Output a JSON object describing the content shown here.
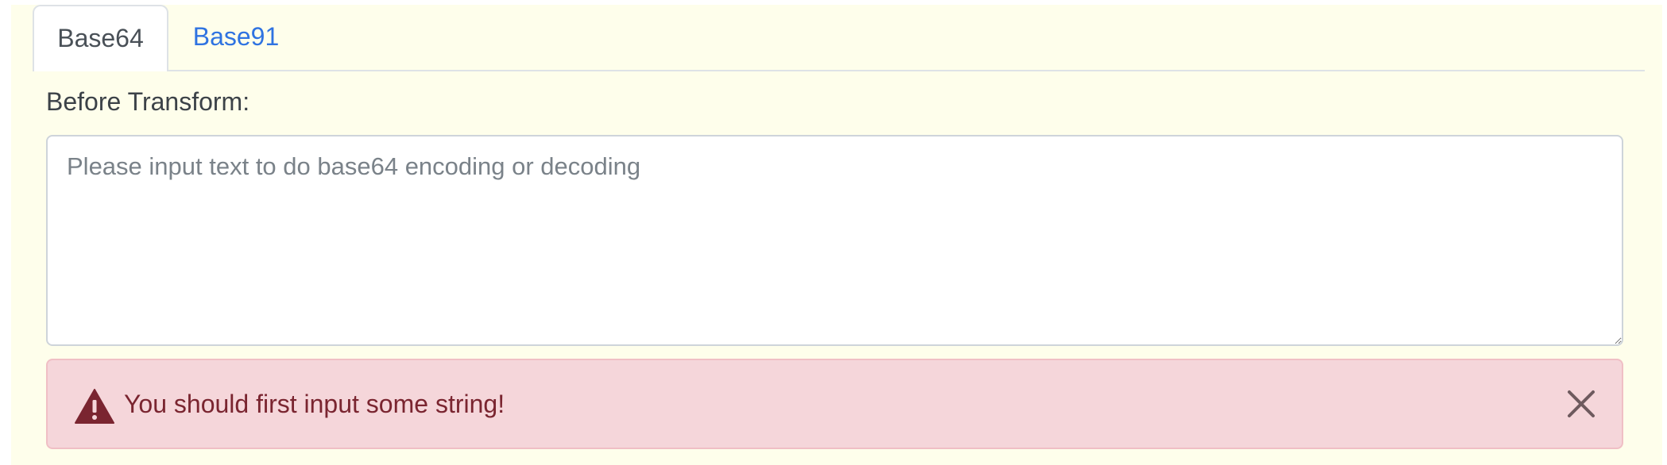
{
  "tabs": [
    {
      "label": "Base64",
      "active": true
    },
    {
      "label": "Base91",
      "active": false
    }
  ],
  "form": {
    "label": "Before Transform:",
    "textarea": {
      "value": "",
      "placeholder": "Please input text to do base64 encoding or decoding"
    }
  },
  "alert": {
    "icon": "warning-triangle-icon",
    "message": "You should first input some string!",
    "close_icon": "close-icon"
  },
  "colors": {
    "page_background": "#fefeeb",
    "active_link": "#2f73e1",
    "alert_background": "#f5d6da",
    "alert_text": "#7a2530"
  }
}
